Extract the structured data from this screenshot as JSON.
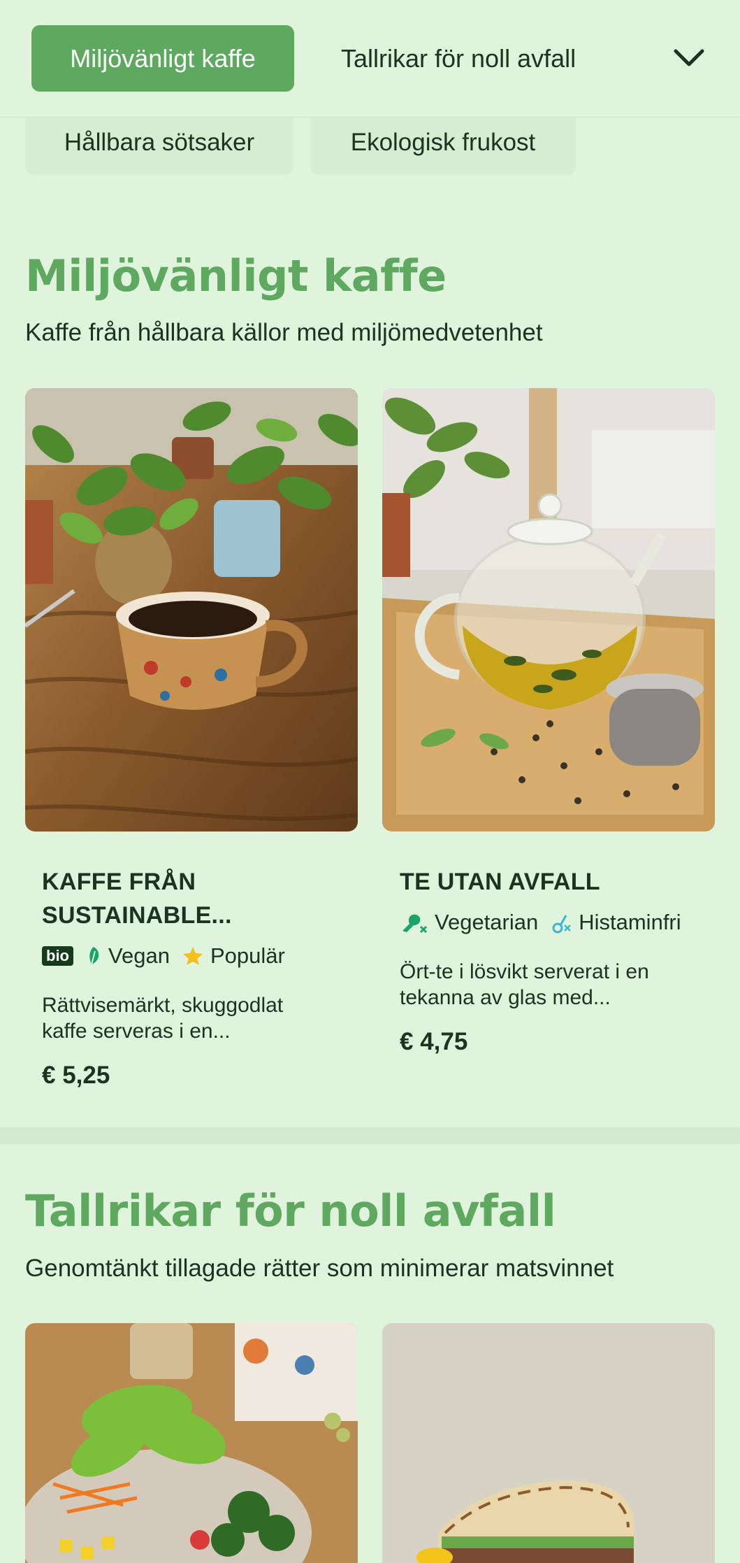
{
  "nav": {
    "active_chip": "Miljövänligt kaffe",
    "second_chip": "Tallrikar för noll avfall",
    "chevron_icon": "chevron-down-icon",
    "row2": [
      "Hållbara sötsaker",
      "Ekologisk frukost"
    ]
  },
  "sections": [
    {
      "title": "Miljövänligt kaffe",
      "subtitle": "Kaffe från hållbara källor med miljömedvetenhet",
      "items": [
        {
          "title_line1": "KAFFE FRÅN",
          "title_line2": "SUSTAINABLE...",
          "tags": [
            {
              "icon": "bio-badge",
              "label": "bio"
            },
            {
              "icon": "leaf-icon",
              "label": "Vegan"
            },
            {
              "icon": "star-icon",
              "label": "Populär"
            }
          ],
          "desc_line1": "Rättvisemärkt, skuggodlat",
          "desc_line2": "kaffe serveras i en...",
          "price": "€ 5,25"
        },
        {
          "title_line1": "TE UTAN AVFALL",
          "tags": [
            {
              "icon": "no-meat-icon",
              "label": "Vegetarian"
            },
            {
              "icon": "no-histamine-icon",
              "label": "Histaminfri"
            }
          ],
          "desc_line1": "Ört-te i lösvikt serverat i en",
          "desc_line2": "tekanna av glas med...",
          "price": "€ 4,75"
        }
      ]
    },
    {
      "title": "Tallrikar för noll avfall",
      "subtitle": "Genomtänkt tillagade rätter som minimerar matsvinnet"
    }
  ],
  "colors": {
    "background": "#dff3dd",
    "accent": "#5ea85f",
    "text": "#1b3320",
    "star": "#f5c01a",
    "leaf": "#1aa36a"
  }
}
